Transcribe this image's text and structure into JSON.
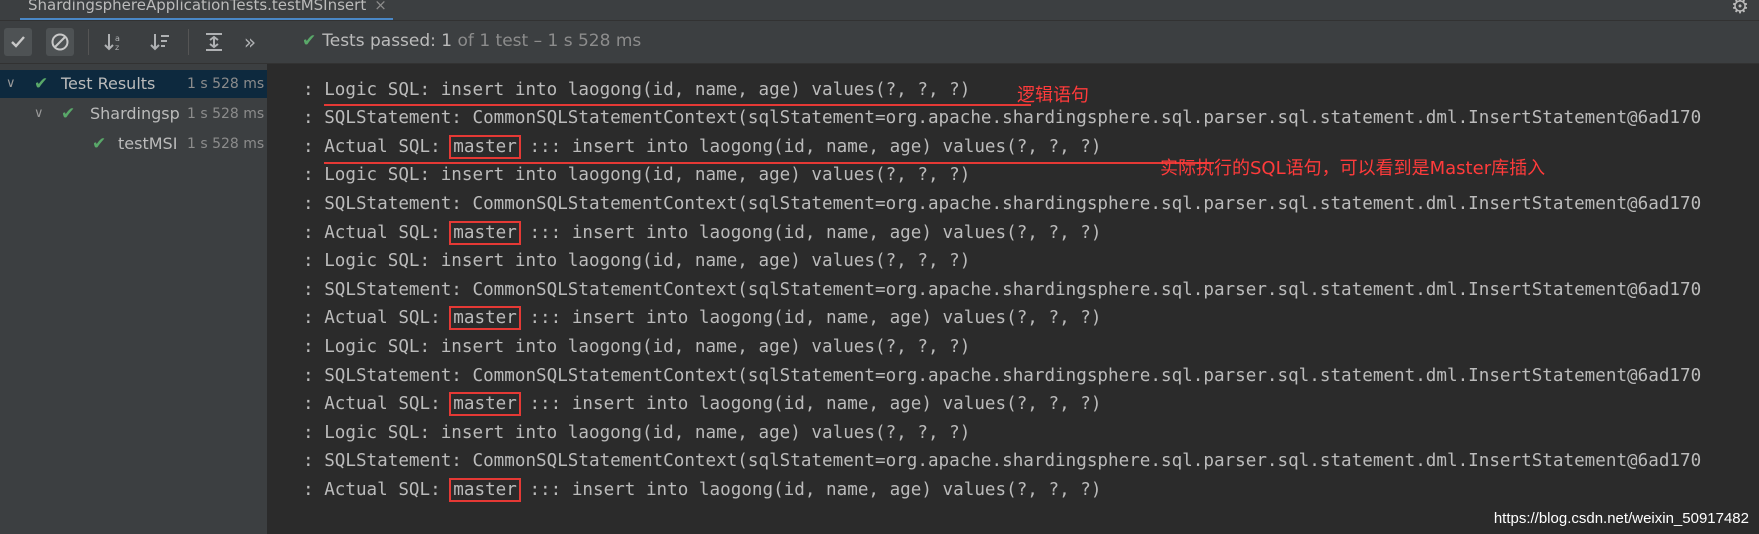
{
  "tab": {
    "title": "ShardingsphereApplicationTests.testMSInsert",
    "close_glyph": "×"
  },
  "toolbar": {
    "status_label": "Tests passed:",
    "status_count": "1",
    "status_rest": "of 1 test – 1 s 528 ms",
    "more_glyph": "»"
  },
  "tree": {
    "root_name": "Test Results",
    "root_time": "1 s 528 ms",
    "class_name": "Shardingsp",
    "class_time": "1 s 528 ms",
    "method_name": "testMSI",
    "method_time": "1 s 528 ms"
  },
  "log": {
    "prefix": ": ",
    "logic": "Logic SQL: insert into laogong(id, name, age) values(?, ?, ?)",
    "statement": "SQLStatement: CommonSQLStatementContext(sqlStatement=org.apache.shardingsphere.sql.parser.sql.statement.dml.InsertStatement@6ad170",
    "actual_label": "Actual SQL: ",
    "actual_ds": "master",
    "actual_rest": " ::: insert into laogong(id, name, age) values(?, ?, ?)"
  },
  "annotations": {
    "logic": "逻辑语句",
    "actual": "实际执行的SQL语句，可以看到是Master库插入"
  },
  "watermark": "https://blog.csdn.net/weixin_50917482",
  "colors": {
    "background": "#2b2b2b",
    "panel": "#3c3f41",
    "pass_green": "#59a869",
    "annotation_red": "#e53935",
    "selection": "#0d293e"
  }
}
